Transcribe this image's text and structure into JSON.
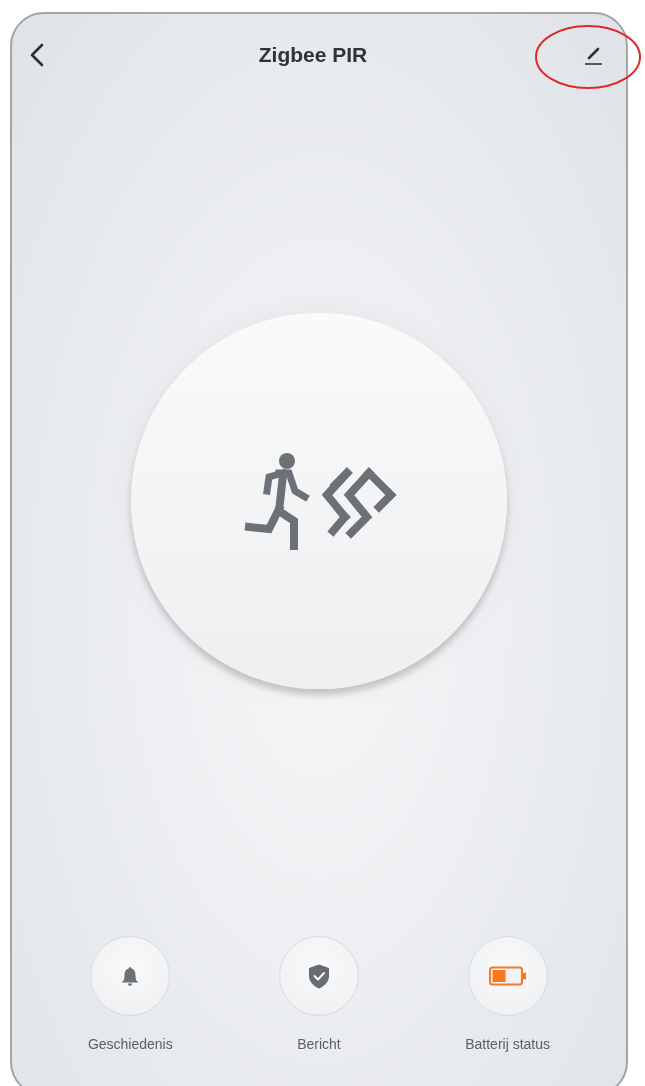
{
  "header": {
    "title": "Zigbee PIR"
  },
  "actions": [
    {
      "kind": "bell",
      "label": "Geschiedenis"
    },
    {
      "kind": "shield",
      "label": "Bericht"
    },
    {
      "kind": "battery",
      "label": "Batterij status"
    }
  ]
}
